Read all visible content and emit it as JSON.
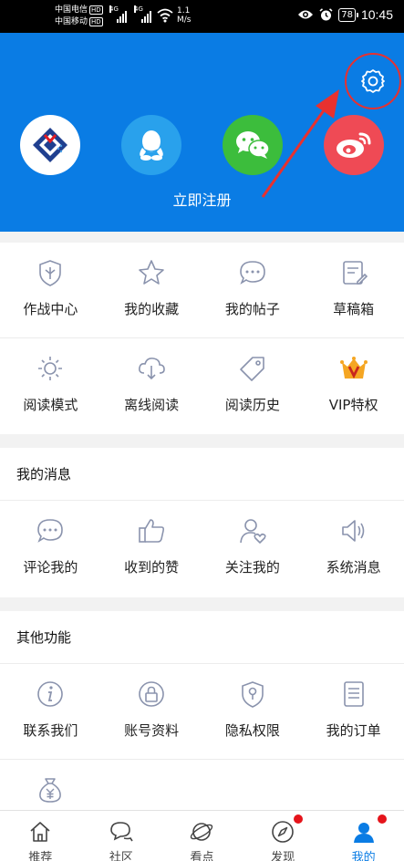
{
  "status_bar": {
    "carrier1": "中国电信",
    "carrier2": "中国移动",
    "hd": "HD",
    "network": "4G",
    "speed_value": "1.1",
    "speed_unit": "M/s",
    "battery": "78",
    "time": "10:45"
  },
  "header": {
    "register_label": "立即注册",
    "login_options": [
      "platform-logo",
      "qq-icon",
      "wechat-icon",
      "weibo-icon"
    ],
    "colors": {
      "background": "#0a7ce4",
      "highlight": "#e8312f"
    }
  },
  "tools": {
    "row1": [
      "作战中心",
      "我的收藏",
      "我的帖子",
      "草稿箱"
    ],
    "row2": [
      "阅读模式",
      "离线阅读",
      "阅读历史",
      "VIP特权"
    ]
  },
  "messages": {
    "title": "我的消息",
    "items": [
      "评论我的",
      "收到的赞",
      "关注我的",
      "系统消息"
    ]
  },
  "other": {
    "title": "其他功能",
    "items": [
      "联系我们",
      "账号资料",
      "隐私权限",
      "我的订单"
    ]
  },
  "bottom_nav": {
    "items": [
      "推荐",
      "社区",
      "看点",
      "发现",
      "我的"
    ],
    "active": "我的"
  }
}
